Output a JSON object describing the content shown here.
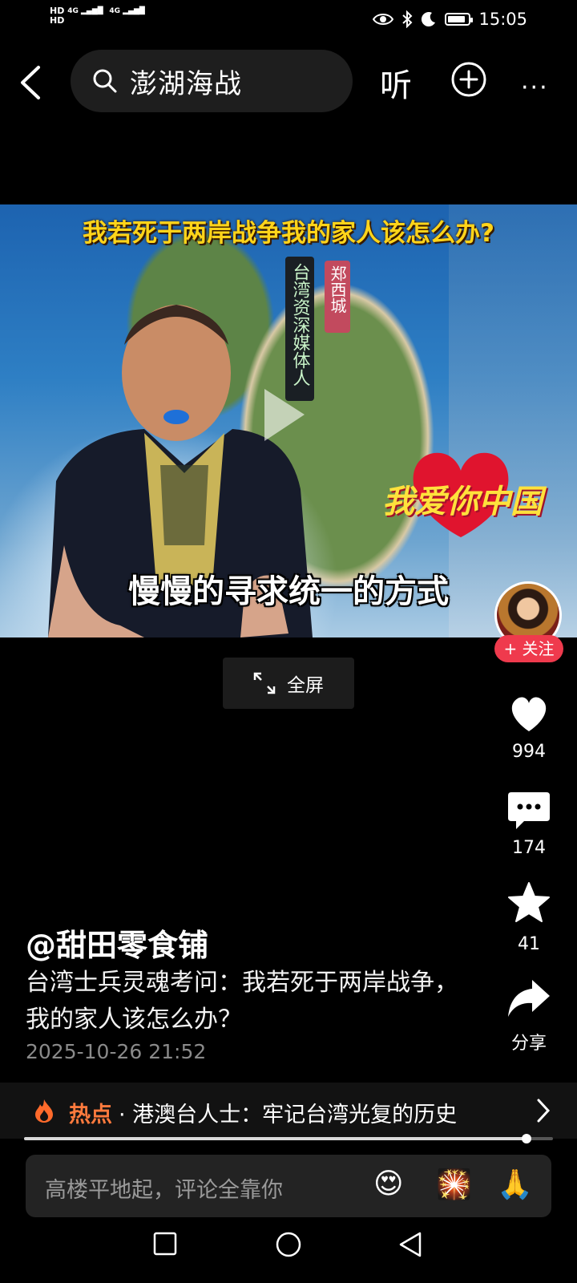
{
  "status_bar": {
    "left_top": "HD",
    "left_bottom": "HD",
    "network1": "4G",
    "network2": "4G",
    "time": "15:05",
    "battery_level": 0.85
  },
  "top_bar": {
    "search_query": "澎湖海战",
    "listen_label": "听"
  },
  "video": {
    "title_overlay": "我若死于两岸战争我的家人该怎么办?",
    "tag_name": "郑西城",
    "tag_role": "台湾资深媒体人",
    "logo_text": "我爱你中国",
    "subtitle": "慢慢的寻求统一的方式",
    "fullscreen_label": "全屏"
  },
  "creator": {
    "follow_label": "+ 关注",
    "handle": "@甜田零食铺"
  },
  "actions": {
    "likes": "994",
    "comments": "174",
    "favorites": "41",
    "share_label": "分享"
  },
  "post": {
    "description": "台湾士兵灵魂考问：我若死于两岸战争，我的家人该怎么办？",
    "date": "2025-10-26 21:52"
  },
  "hot": {
    "label": "热点",
    "text": "· 港澳台人士：牢记台湾光复的历史"
  },
  "playback": {
    "progress": 0.95
  },
  "comment": {
    "placeholder": "高楼平地起，评论全靠你",
    "emojis": [
      "😍",
      "🎇",
      "🙏"
    ]
  },
  "colors": {
    "accent_red": "#ef3a4d",
    "hot_orange": "#ff7a3d",
    "title_yellow": "#ffd41a"
  }
}
